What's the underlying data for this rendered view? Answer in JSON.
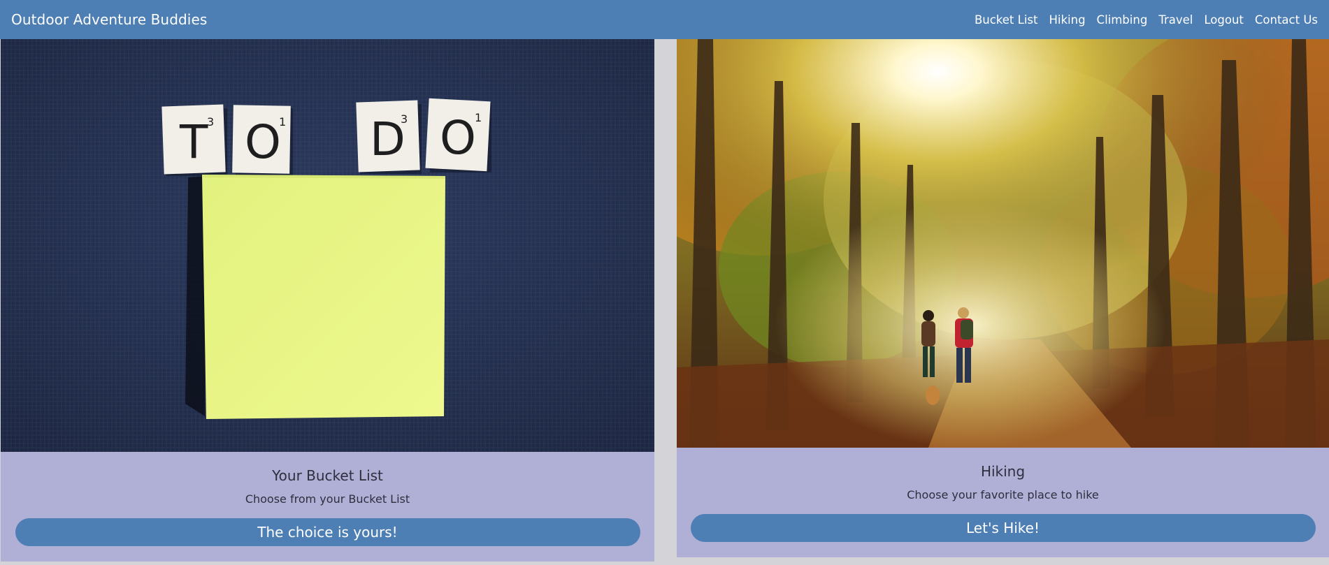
{
  "navbar": {
    "brand": "Outdoor Adventure Buddies",
    "links": [
      "Bucket List",
      "Hiking",
      "Climbing",
      "Travel",
      "Logout",
      "Contact Us"
    ],
    "background": "#4d7eb4"
  },
  "cards": [
    {
      "title": "Your Bucket List",
      "text": "Choose from your Bucket List",
      "button": "The choice is yours!",
      "image": {
        "tiles": [
          {
            "letter": "T",
            "points": "3"
          },
          {
            "letter": "O",
            "points": "1"
          },
          {
            "letter": "D",
            "points": "3"
          },
          {
            "letter": "O",
            "points": "1"
          }
        ]
      }
    },
    {
      "title": "Hiking",
      "text": "Choose your favorite place to hike",
      "button": "Let's Hike!"
    }
  ],
  "colors": {
    "card_body": "#b0b0d6",
    "button": "#4d7eb4",
    "page": "#d4d4d8"
  }
}
